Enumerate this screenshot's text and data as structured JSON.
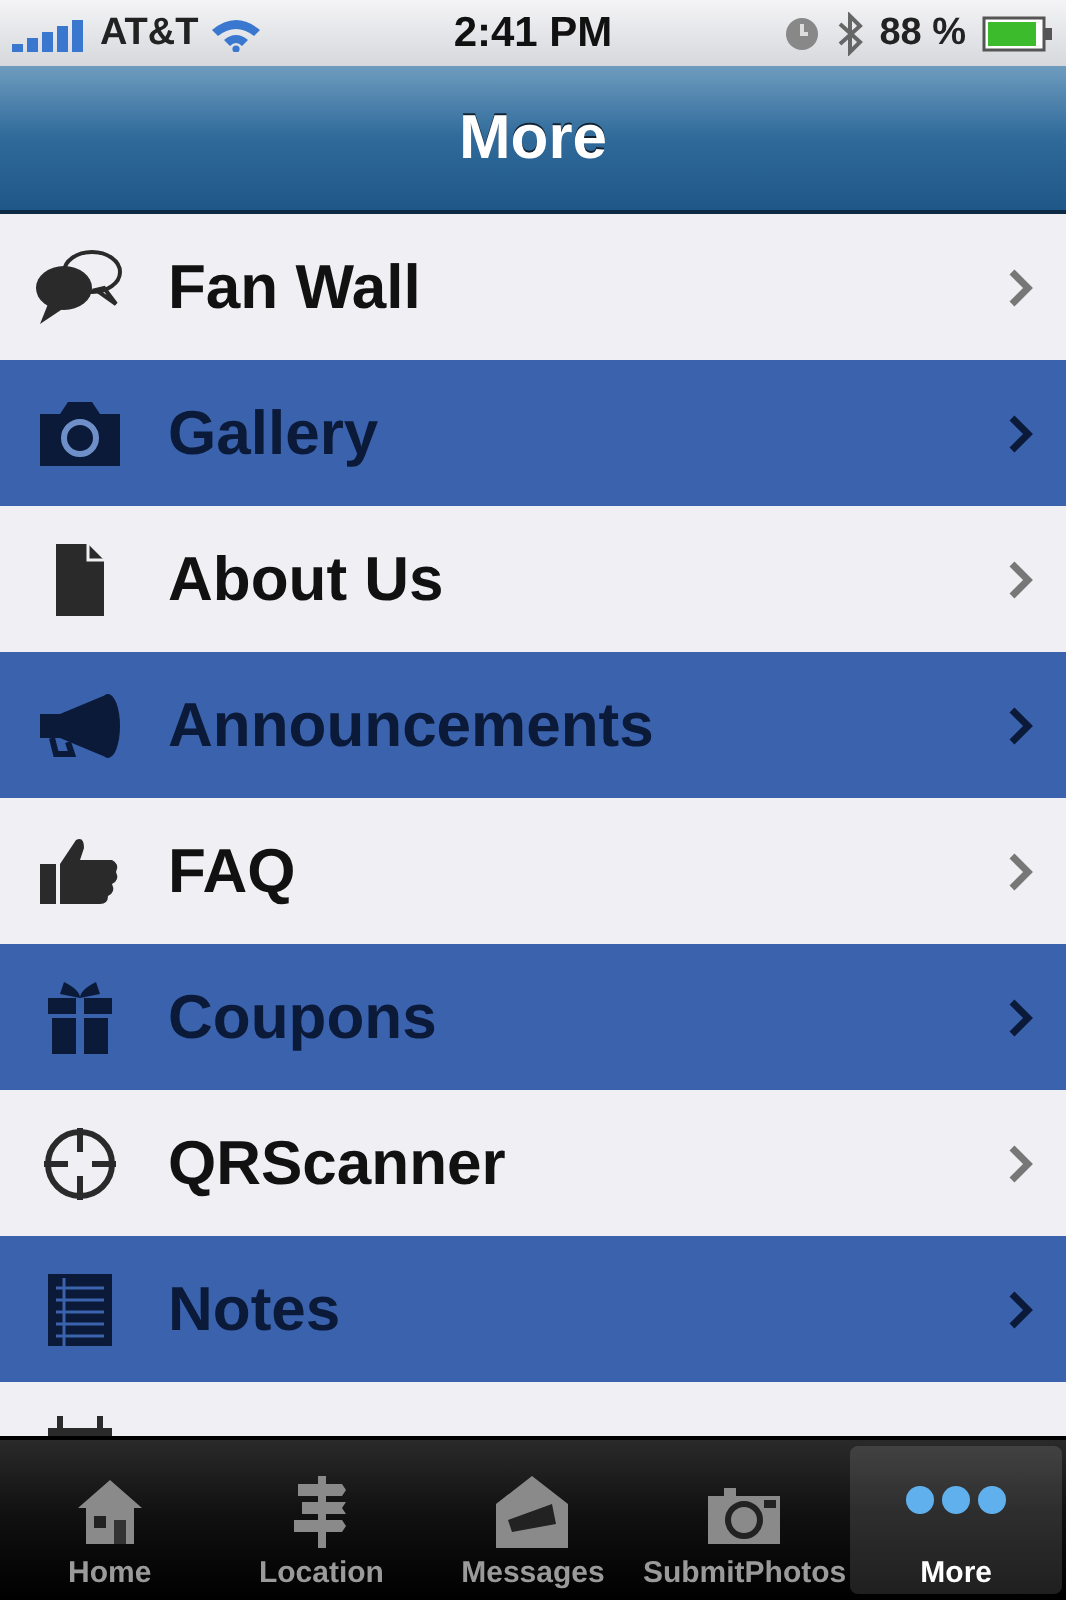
{
  "status_bar": {
    "carrier": "AT&T",
    "time": "2:41 PM",
    "battery": "88 %"
  },
  "nav_bar": {
    "title": "More"
  },
  "items": [
    {
      "label": "Fan Wall",
      "kind": "light"
    },
    {
      "label": "Gallery",
      "kind": "dark"
    },
    {
      "label": "About Us",
      "kind": "light"
    },
    {
      "label": "Announcements",
      "kind": "dark"
    },
    {
      "label": "FAQ",
      "kind": "light"
    },
    {
      "label": "Coupons",
      "kind": "dark"
    },
    {
      "label": "QRScanner",
      "kind": "light"
    },
    {
      "label": "Notes",
      "kind": "dark"
    },
    {
      "kind": "light"
    }
  ],
  "tabs": [
    {
      "label": "Home",
      "selected": false
    },
    {
      "label": "Location",
      "selected": false
    },
    {
      "label": "Messages",
      "selected": false
    },
    {
      "label": "SubmitPhotos",
      "selected": false
    },
    {
      "label": "More",
      "selected": true
    }
  ]
}
